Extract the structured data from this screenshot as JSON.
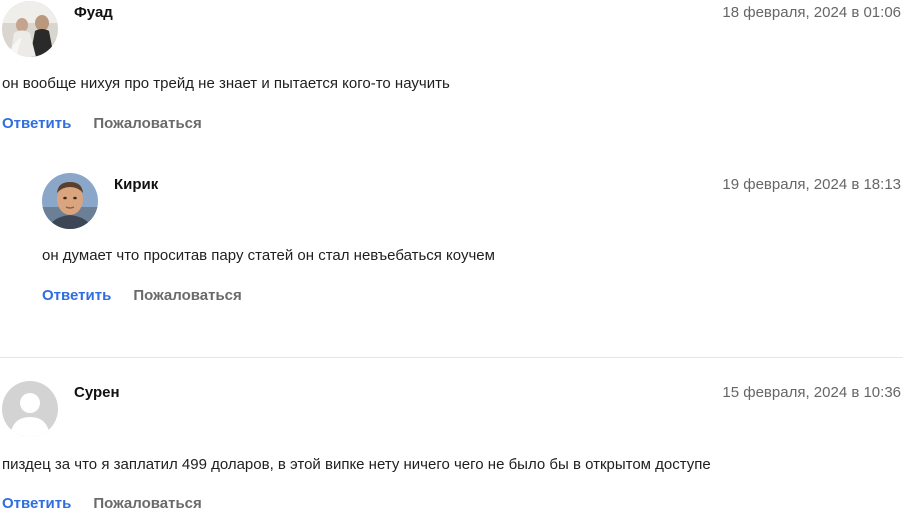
{
  "comments": [
    {
      "author": "Фуад",
      "date": "18 февраля, 2024 в 01:06",
      "text": "он вообще нихуя про трейд не знает и пытается кого-то научить",
      "reply_label": "Ответить",
      "report_label": "Пожаловаться",
      "avatar": "photo-avatar"
    },
    {
      "author": "Кирик",
      "date": "19 февраля, 2024 в 18:13",
      "text": "он думает что проситав пару статей он стал невъебаться коучем",
      "reply_label": "Ответить",
      "report_label": "Пожаловаться",
      "avatar": "photo-avatar"
    },
    {
      "author": "Сурен",
      "date": "15 февраля, 2024 в 10:36",
      "text": "пиздец за что я заплатил 499 доларов, в этой випке нету ничего чего не было бы в открытом доступе",
      "reply_label": "Ответить",
      "report_label": "Пожаловаться",
      "avatar": "default-user-avatar"
    }
  ],
  "colors": {
    "link": "#2f6de1",
    "muted": "#6a6a6a",
    "date": "#666666",
    "divider": "#e6e6e6"
  }
}
